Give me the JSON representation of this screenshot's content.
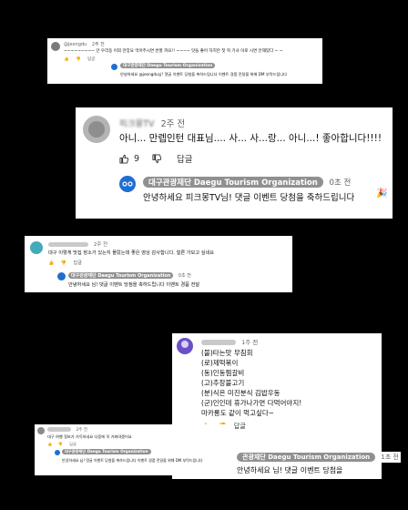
{
  "card1": {
    "author": "@jeongdu",
    "time": "2주 전",
    "comment": "~~~~~~~~~ 안 우리동 이외 만장요 먹어주시면 반할 까요!! ~~~~ 맛들 좋어 하지만 첫 혁 기사 이로 시면 안재밌다 ~ ~",
    "likes": "",
    "reply": "답글",
    "org_badge": "대구관광재단 Daegu Tourism Organization",
    "reply_text": "안녕하세요 @jeongdu님! 댓글 이벤트 당첨을 축하드립니다 이벤트 경품 전달을 위해 DM 부탁드립니다"
  },
  "card2": {
    "author": "피크몽TV",
    "time": "2주 전",
    "comment": "아니... 만렙인턴 대표님.... 사... 사...랑... 아니...! 좋아합니다!!!!",
    "likes": "9",
    "reply": "답글",
    "org_badge": "대구관광재단 Daegu Tourism Organization",
    "org_time": "0초 전",
    "reply_text": "안녕하세요 피크몽TV님! 댓글 이벤트 당첨을 축하드립니다"
  },
  "card3": {
    "time": "2주 전",
    "comment": "대구 이렇게 맛집 장소가 있는지 몰랐는데 좋은 영상 감사합니다. 얼른 가보고 싶네요",
    "likes": "",
    "reply": "답글",
    "org_badge": "대구관광재단 Daegu Tourism Organization",
    "org_time": "0초 전",
    "reply_text": "안녕하세요 님! 댓글 이벤트 당첨을 축하드립니다 이벤트 경품 전달"
  },
  "card4": {
    "time": "1주 전",
    "lines": [
      "(불)타는맛 무침회",
      "(로)제떡볶이",
      "(동)인동찜갈비",
      "(고)추장불고기",
      "(분)식은 미진분식 김밥우동",
      "(군)인인데 휴가나가면 다먹어야지!",
      "마카롱도 같이 먹고싶다~"
    ],
    "likes": "",
    "reply": "답글",
    "org_badge": "관광재단 Daegu Tourism Organization",
    "org_time": "1초 전",
    "reply_text": "안녕하세요 님! 댓글 이벤트 당첨을"
  },
  "card5": {
    "time": "2주 전",
    "comment": "대구 여행 정보가 가득하네요 다음에 꼭 가봐야겠어요",
    "likes": "",
    "reply": "답글",
    "org_badge": "대구관광재단 Daegu Tourism Organization",
    "reply_text": "안녕하세요 님! 댓글 이벤트 당첨을 축하드립니다 이벤트 경품 전달을 위해 DM 부탁드립니다"
  },
  "colors": {
    "org_logo": "#1f6fd0",
    "badge_bg": "#909090",
    "avatar_purple": "#6b4fc7",
    "avatar_teal": "#44aabb"
  }
}
